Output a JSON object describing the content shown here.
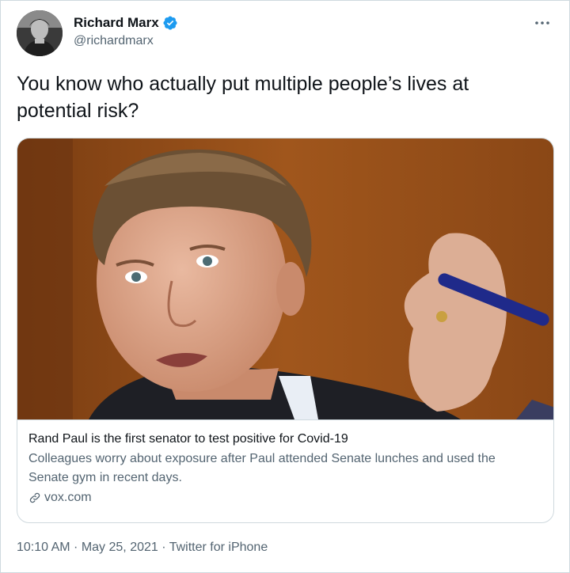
{
  "author": {
    "display_name": "Richard Marx",
    "handle": "@richardmarx",
    "verified": true,
    "avatar_icon": "profile-photo"
  },
  "tweet": {
    "text": "You know who actually put multiple people’s lives at potential risk?"
  },
  "card": {
    "title": "Rand Paul is the first senator to test positive for Covid-19",
    "description": "Colleagues worry about exposure after Paul attended Senate lunches and used the Senate gym in recent days.",
    "domain": "vox.com",
    "image_icon": "news-photo"
  },
  "meta": {
    "time": "10:10 AM",
    "separator": " · ",
    "date": "May 25, 2021",
    "source": "Twitter for iPhone"
  },
  "colors": {
    "verified_blue": "#1d9bf0",
    "secondary_text": "#536471",
    "border": "#cfd9de"
  }
}
